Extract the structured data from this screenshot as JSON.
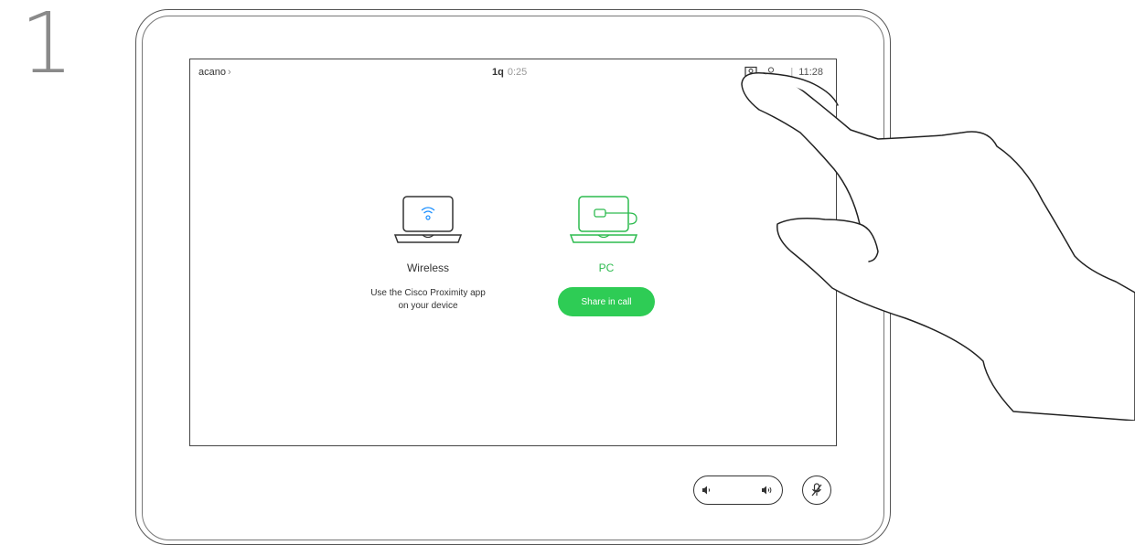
{
  "step": {
    "number": "1"
  },
  "status_bar": {
    "left_label": "acano",
    "left_chevron": "›",
    "call_name": "1q",
    "call_duration": "0:25",
    "separator": "|",
    "clock": "11:28",
    "icons": [
      "share-screen-icon",
      "person-icon"
    ]
  },
  "options": {
    "wireless": {
      "label": "Wireless",
      "description_line1": "Use the Cisco Proximity app",
      "description_line2": "on your device",
      "icon": "laptop-wifi-icon"
    },
    "pc": {
      "label": "PC",
      "button_label": "Share in call",
      "icon": "laptop-cable-icon"
    }
  },
  "controls": {
    "volume_down_icon": "speaker-low-icon",
    "volume_up_icon": "speaker-high-icon",
    "mute_icon": "microphone-muted-icon"
  },
  "colors": {
    "accent": "#2ecc55",
    "pc_label": "#2dbb4f",
    "text": "#333333",
    "muted_text": "#999999"
  }
}
